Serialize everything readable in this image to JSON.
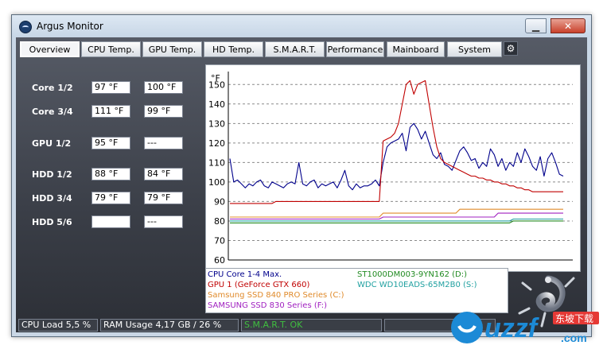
{
  "window": {
    "title": "Argus Monitor"
  },
  "tabs": [
    {
      "label": "Overview",
      "active": true
    },
    {
      "label": "CPU Temp.",
      "active": false
    },
    {
      "label": "GPU Temp.",
      "active": false
    },
    {
      "label": "HD Temp.",
      "active": false
    },
    {
      "label": "S.M.A.R.T.",
      "active": false
    },
    {
      "label": "Performance",
      "active": false
    },
    {
      "label": "Mainboard",
      "active": false
    },
    {
      "label": "System",
      "active": false
    }
  ],
  "sensors": [
    {
      "label": "Core 1/2",
      "a": "97 °F",
      "b": "100 °F"
    },
    {
      "label": "Core 3/4",
      "a": "111 °F",
      "b": "99 °F"
    },
    {
      "label": "GPU 1/2",
      "a": "95 °F",
      "b": "---"
    },
    {
      "label": "HDD 1/2",
      "a": "88 °F",
      "b": "84 °F"
    },
    {
      "label": "HDD 3/4",
      "a": "79 °F",
      "b": "79 °F"
    },
    {
      "label": "HDD 5/6",
      "a": "",
      "b": "---"
    }
  ],
  "chart_data": {
    "type": "line",
    "ylabel": "°F",
    "ylim": [
      60,
      155
    ],
    "yticks": [
      "150",
      "140",
      "130",
      "120",
      "110",
      "100",
      "90",
      "80",
      "70",
      "60"
    ],
    "grid": true,
    "series": [
      {
        "name": "CPU Core 1-4 Max.",
        "color": "#00008b",
        "values": [
          112,
          100,
          101,
          99,
          97,
          99,
          98,
          100,
          101,
          98,
          97,
          100,
          99,
          98,
          97,
          99,
          100,
          99,
          110,
          99,
          98,
          100,
          101,
          97,
          99,
          98,
          99,
          100,
          97,
          101,
          106,
          98,
          96,
          99,
          97,
          98,
          98,
          99,
          101,
          98,
          110,
          118,
          120,
          121,
          122,
          125,
          116,
          128,
          130,
          127,
          122,
          126,
          120,
          114,
          112,
          115,
          109,
          108,
          106,
          111,
          116,
          118,
          115,
          111,
          112,
          107,
          110,
          108,
          117,
          114,
          108,
          112,
          106,
          110,
          108,
          115,
          110,
          117,
          113,
          108,
          106,
          113,
          103,
          112,
          115,
          110,
          104,
          103
        ]
      },
      {
        "name": "GPU 1 (GeForce GTX 660)",
        "color": "#c00000",
        "values": [
          89,
          89,
          89,
          89,
          89,
          89,
          89,
          89,
          89,
          89,
          89,
          89,
          90,
          90,
          90,
          90,
          90,
          90,
          90,
          90,
          90,
          90,
          90,
          90,
          90,
          90,
          90,
          90,
          90,
          90,
          90,
          90,
          90,
          90,
          90,
          90,
          90,
          90,
          90,
          90,
          121,
          122,
          123,
          125,
          130,
          140,
          150,
          152,
          145,
          150,
          151,
          152,
          140,
          128,
          118,
          112,
          110,
          109,
          108,
          107,
          106,
          105,
          104,
          103,
          103,
          102,
          102,
          101,
          101,
          100,
          100,
          99,
          99,
          98,
          98,
          97,
          97,
          96,
          96,
          95,
          95,
          95,
          95,
          95,
          95,
          95,
          95,
          95
        ]
      },
      {
        "name": "Samsung SSD 840 PRO Series (C:)",
        "color": "#e08a2a",
        "values": [
          82,
          82,
          82,
          82,
          82,
          82,
          82,
          82,
          82,
          82,
          82,
          82,
          82,
          82,
          82,
          82,
          82,
          82,
          82,
          82,
          82,
          82,
          82,
          82,
          82,
          82,
          82,
          82,
          82,
          82,
          82,
          82,
          82,
          82,
          82,
          82,
          82,
          82,
          82,
          82,
          84,
          84,
          84,
          84,
          84,
          84,
          84,
          84,
          84,
          84,
          84,
          84,
          84,
          84,
          84,
          84,
          84,
          84,
          84,
          84,
          86,
          86,
          86,
          86,
          86,
          86,
          86,
          86,
          86,
          86,
          86,
          86,
          86,
          86,
          86,
          86,
          86,
          86,
          86,
          86,
          86,
          86,
          86,
          86,
          86,
          86,
          86,
          86
        ]
      },
      {
        "name": "SAMSUNG SSD 830 Series (F:)",
        "color": "#a020c0",
        "values": [
          81,
          81,
          81,
          81,
          81,
          81,
          81,
          81,
          81,
          81,
          81,
          81,
          81,
          81,
          81,
          81,
          81,
          81,
          81,
          81,
          81,
          81,
          81,
          81,
          81,
          81,
          81,
          81,
          81,
          81,
          81,
          81,
          81,
          81,
          81,
          81,
          81,
          81,
          81,
          81,
          82,
          82,
          82,
          82,
          82,
          82,
          82,
          82,
          82,
          82,
          82,
          82,
          82,
          82,
          82,
          82,
          82,
          82,
          82,
          82,
          82,
          82,
          82,
          82,
          82,
          82,
          82,
          82,
          82,
          82,
          84,
          84,
          84,
          84,
          84,
          84,
          84,
          84,
          84,
          84,
          84,
          84,
          84,
          84,
          84,
          84,
          84,
          84
        ]
      },
      {
        "name": "ST1000DM003-9YN162 (D:)",
        "color": "#208a20",
        "values": [
          79,
          79,
          79,
          79,
          79,
          79,
          79,
          79,
          79,
          79,
          79,
          79,
          79,
          79,
          79,
          79,
          79,
          79,
          79,
          79,
          79,
          79,
          79,
          79,
          79,
          79,
          79,
          79,
          79,
          79,
          79,
          79,
          79,
          79,
          79,
          79,
          79,
          79,
          79,
          79,
          79,
          79,
          79,
          79,
          79,
          79,
          79,
          79,
          79,
          79,
          79,
          79,
          79,
          79,
          79,
          79,
          79,
          79,
          79,
          79,
          79,
          79,
          79,
          79,
          79,
          79,
          79,
          79,
          79,
          79,
          79,
          79,
          79,
          79,
          80,
          80,
          80,
          80,
          80,
          80,
          80,
          80,
          80,
          80,
          80,
          80,
          80,
          80
        ]
      },
      {
        "name": "WDC WD10EADS-65M2B0 (S:)",
        "color": "#20a0a0",
        "values": [
          80,
          80,
          80,
          80,
          80,
          80,
          80,
          80,
          80,
          80,
          80,
          80,
          80,
          80,
          80,
          80,
          80,
          80,
          80,
          80,
          80,
          80,
          80,
          80,
          80,
          80,
          80,
          80,
          80,
          80,
          80,
          80,
          80,
          80,
          80,
          80,
          80,
          80,
          80,
          80,
          80,
          80,
          80,
          80,
          80,
          80,
          80,
          80,
          80,
          80,
          80,
          80,
          80,
          80,
          80,
          80,
          80,
          80,
          80,
          80,
          80,
          80,
          80,
          80,
          80,
          80,
          80,
          80,
          80,
          80,
          80,
          80,
          80,
          80,
          81,
          81,
          81,
          81,
          81,
          81,
          81,
          81,
          81,
          81,
          81,
          81,
          81,
          81
        ]
      }
    ]
  },
  "status": {
    "cpu_load": "CPU Load 5,5 %",
    "ram": "RAM Usage 4,17 GB / 26 %",
    "smart": "S.M.A.R.T. OK",
    "smart_color": "#3fbf3f",
    "extra": ""
  },
  "watermark": {
    "text": "uzzf",
    "cn": "东坡下载",
    "dotcom": ".com"
  }
}
